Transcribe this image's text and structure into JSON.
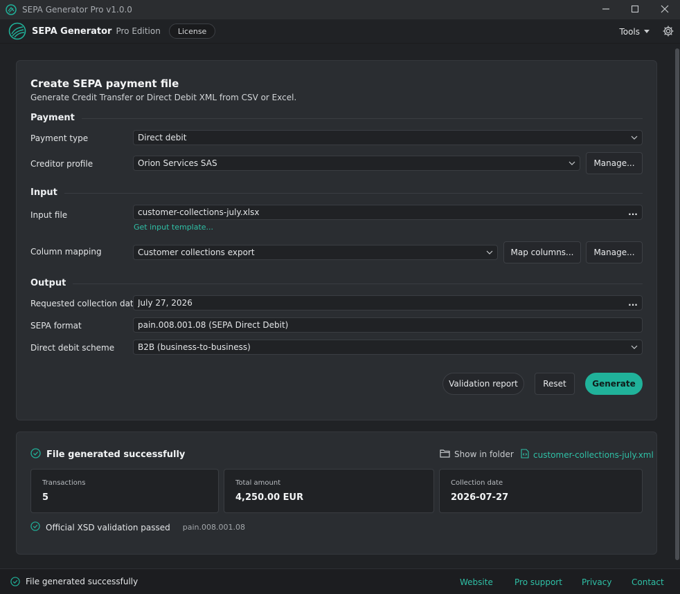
{
  "window": {
    "title": "SEPA Generator Pro v1.0.0"
  },
  "appbar": {
    "brand_name": "SEPA Generator",
    "edition": "Pro Edition",
    "license_label": "License",
    "tools_label": "Tools"
  },
  "form": {
    "title": "Create SEPA payment file",
    "subtitle": "Generate Credit Transfer or Direct Debit XML from CSV or Excel.",
    "sections": {
      "payment": "Payment",
      "input": "Input",
      "output": "Output"
    },
    "payment_type": {
      "label": "Payment type",
      "value": "Direct debit"
    },
    "creditor_profile": {
      "label": "Creditor profile",
      "value": "Orion Services SAS",
      "manage_label": "Manage..."
    },
    "input_file": {
      "label": "Input file",
      "value": "customer-collections-july.xlsx",
      "browse_label": "...",
      "template_link": "Get input template..."
    },
    "column_mapping": {
      "label": "Column mapping",
      "value": "Customer collections export",
      "map_label": "Map columns...",
      "manage_label": "Manage..."
    },
    "collection_date": {
      "label": "Requested collection date",
      "value": "July 27, 2026",
      "browse_label": "..."
    },
    "sepa_format": {
      "label": "SEPA format",
      "value": "pain.008.001.08 (SEPA Direct Debit)"
    },
    "scheme": {
      "label": "Direct debit scheme",
      "value": "B2B (business-to-business)"
    },
    "actions": {
      "validation_report": "Validation report",
      "reset": "Reset",
      "generate": "Generate"
    }
  },
  "result": {
    "heading": "File generated successfully",
    "show_in_folder": "Show in folder",
    "file_name": "customer-collections-july.xml",
    "stats": [
      {
        "label": "Transactions",
        "value": "5"
      },
      {
        "label": "Total amount",
        "value": "4,250.00 EUR"
      },
      {
        "label": "Collection date",
        "value": "2026-07-27"
      }
    ],
    "xsd_message": "Official XSD validation passed",
    "xsd_format": "pain.008.001.08"
  },
  "statusbar": {
    "status": "File generated successfully",
    "links": [
      "Website",
      "Pro support",
      "Privacy",
      "Contact"
    ]
  },
  "colors": {
    "accent": "#20b29a",
    "background": "#202225",
    "card": "#2a2d31"
  }
}
